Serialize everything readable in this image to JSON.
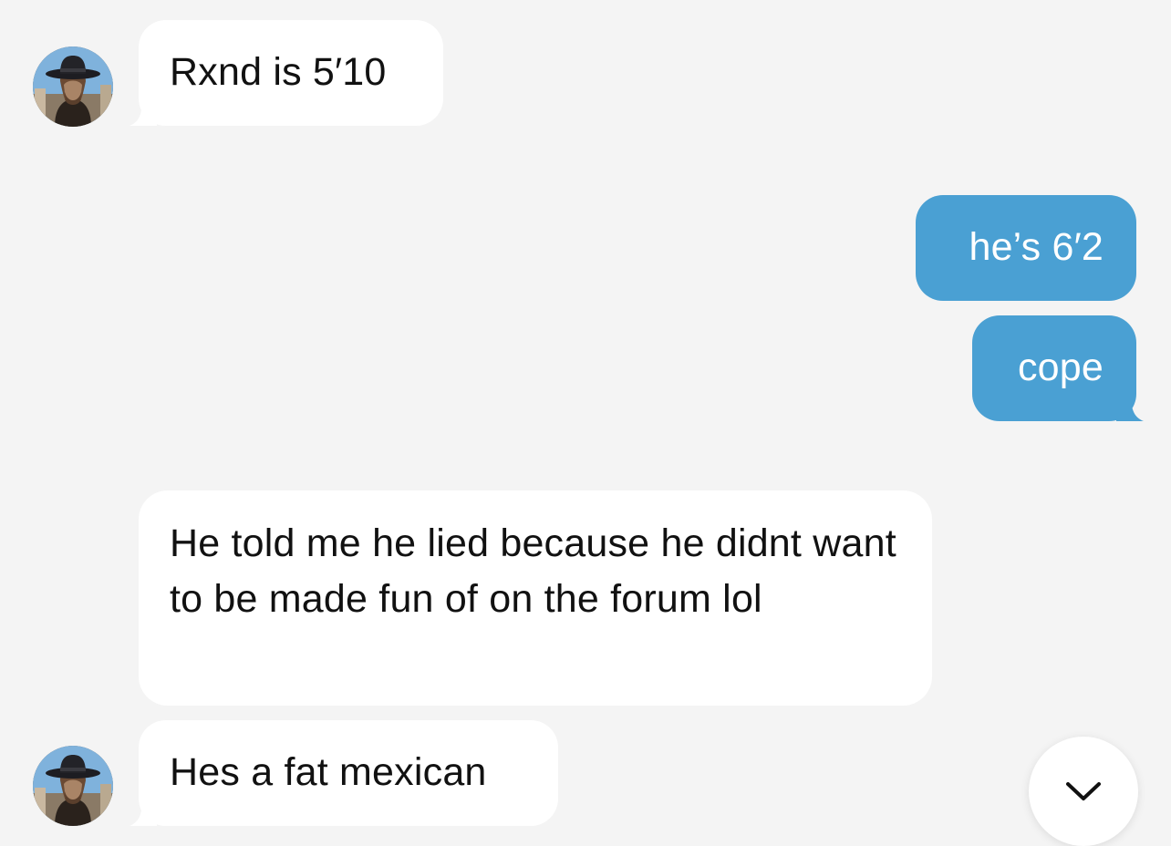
{
  "messages": [
    {
      "direction": "incoming",
      "text": "Rxnd is 5′10",
      "avatar": "profile-photo-man-in-hat"
    },
    {
      "direction": "outgoing",
      "text": "he’s 6′2"
    },
    {
      "direction": "outgoing",
      "text": "cope"
    },
    {
      "direction": "incoming",
      "text": "He told me he lied because he didnt want to be made fun of on the forum lol"
    },
    {
      "direction": "incoming",
      "text": "Hes a fat mexican",
      "avatar": "profile-photo-man-in-hat"
    }
  ],
  "scroll_button": {
    "icon": "chevron-down-icon"
  },
  "colors": {
    "background": "#f4f4f4",
    "incoming_bubble": "#ffffff",
    "outgoing_bubble": "#4aa0d3",
    "incoming_text": "#111111",
    "outgoing_text": "#ffffff"
  }
}
